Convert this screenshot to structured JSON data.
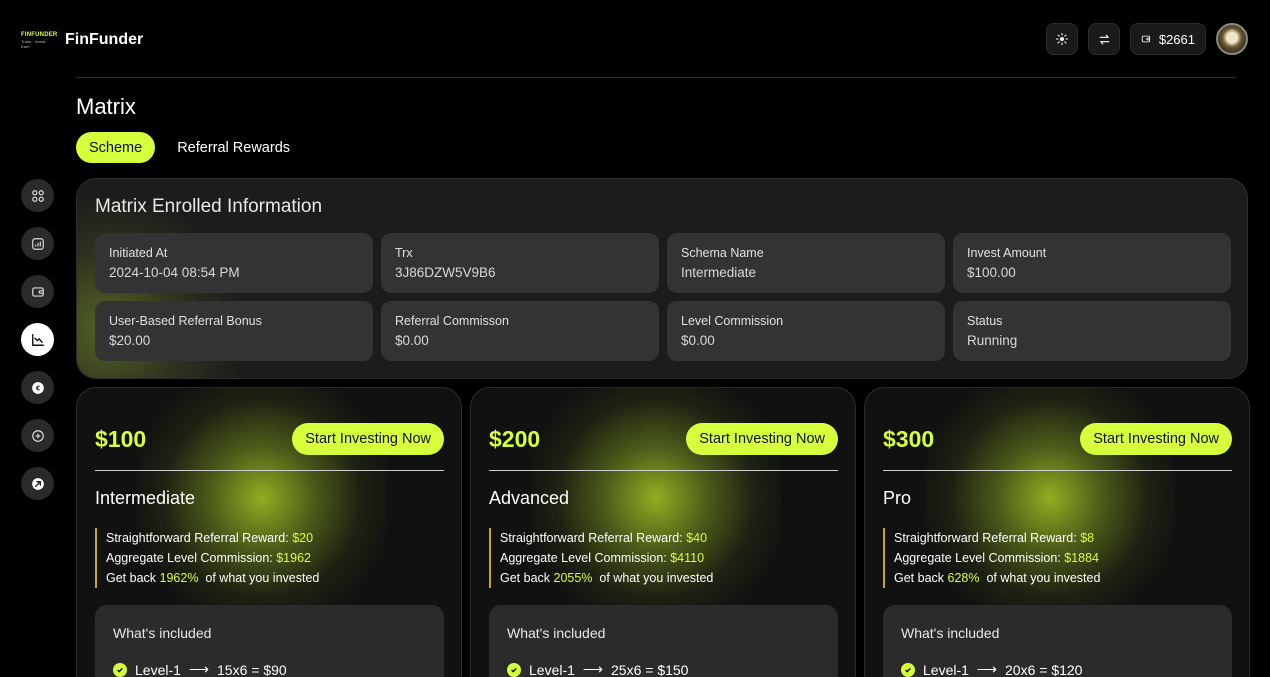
{
  "app": {
    "logo_text": "FINFUNDER",
    "logo_tagline": "Trade · Invest · Earn",
    "brand": "FinFunder"
  },
  "header": {
    "balance": "$2661"
  },
  "page": {
    "title": "Matrix",
    "tabs": [
      {
        "label": "Scheme",
        "active": true
      },
      {
        "label": "Referral Rewards",
        "active": false
      }
    ]
  },
  "sidebar": {
    "items": [
      {
        "icon": "dashboard-icon"
      },
      {
        "icon": "chart-icon"
      },
      {
        "icon": "wallet-icon"
      },
      {
        "icon": "trend-icon",
        "active": true
      },
      {
        "icon": "euro-icon"
      },
      {
        "icon": "plus-circle-icon"
      },
      {
        "icon": "arrow-up-right-icon"
      }
    ]
  },
  "enrolled": {
    "title": "Matrix Enrolled Information",
    "items": [
      {
        "label": "Initiated At",
        "value": "2024-10-04 08:54 PM"
      },
      {
        "label": "Trx",
        "value": "3J86DZW5V9B6"
      },
      {
        "label": "Schema Name",
        "value": "Intermediate"
      },
      {
        "label": "Invest Amount",
        "value": "$100.00"
      },
      {
        "label": "User-Based Referral Bonus",
        "value": "$20.00"
      },
      {
        "label": "Referral Commisson",
        "value": "$0.00"
      },
      {
        "label": "Level Commission",
        "value": "$0.00"
      },
      {
        "label": "Status",
        "value": "Running"
      }
    ]
  },
  "plans": [
    {
      "price": "$100",
      "button": "Start Investing Now",
      "name": "Intermediate",
      "referral_label": "Straightforward Referral Reward:",
      "referral_value": "$20",
      "commission_label": "Aggregate Level Commission:",
      "commission_value": "$1962",
      "getback_prefix": "Get back",
      "getback_value": "1962%",
      "getback_suffix": "of what you invested",
      "included_title": "What's included",
      "level_label": "Level-1",
      "level_arrow": "⟶",
      "level_value": "15x6 = $90"
    },
    {
      "price": "$200",
      "button": "Start Investing Now",
      "name": "Advanced",
      "referral_label": "Straightforward Referral Reward:",
      "referral_value": "$40",
      "commission_label": "Aggregate Level Commission:",
      "commission_value": "$4110",
      "getback_prefix": "Get back",
      "getback_value": "2055%",
      "getback_suffix": "of what you invested",
      "included_title": "What's included",
      "level_label": "Level-1",
      "level_arrow": "⟶",
      "level_value": "25x6 = $150"
    },
    {
      "price": "$300",
      "button": "Start Investing Now",
      "name": "Pro",
      "referral_label": "Straightforward Referral Reward:",
      "referral_value": "$8",
      "commission_label": "Aggregate Level Commission:",
      "commission_value": "$1884",
      "getback_prefix": "Get back",
      "getback_value": "628%",
      "getback_suffix": "of what you invested",
      "included_title": "What's included",
      "level_label": "Level-1",
      "level_arrow": "⟶",
      "level_value": "20x6 = $120"
    }
  ],
  "colors": {
    "accent": "#d6ff3c",
    "background": "#000000",
    "panel": "#1c1c1c",
    "cell": "#333333",
    "detail_border": "#c9a227"
  }
}
